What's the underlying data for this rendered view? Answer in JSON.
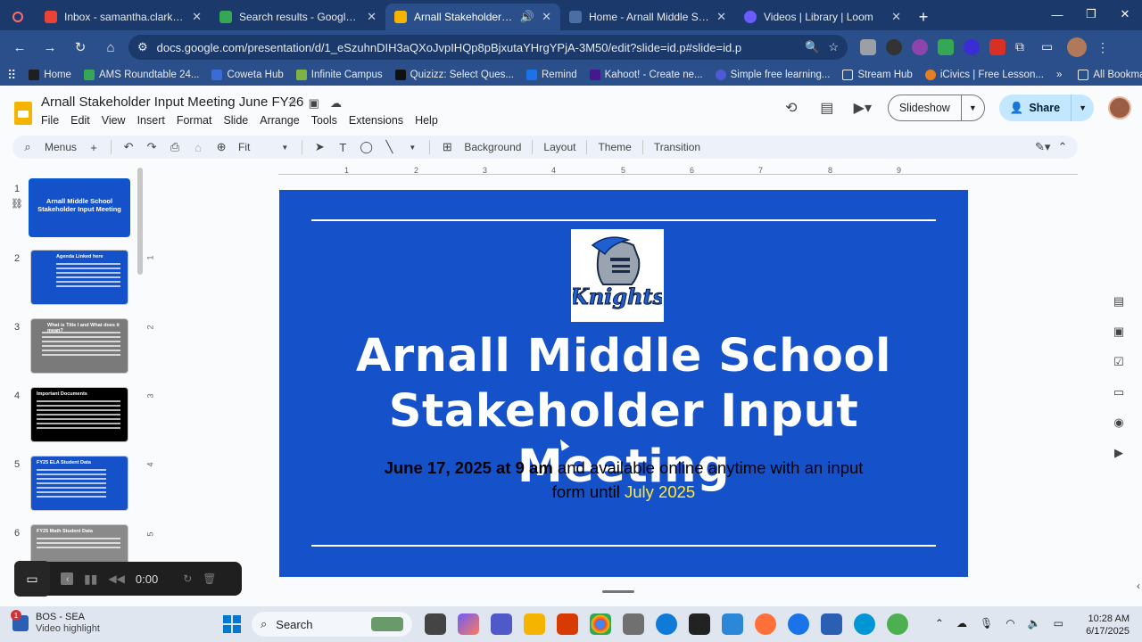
{
  "browser": {
    "tabs": [
      {
        "title": "Inbox - samantha.clark@coweta",
        "color": "#ea4335",
        "active": false
      },
      {
        "title": "Search results - Google Drive",
        "color": "#34a853",
        "active": false
      },
      {
        "title": "Arnall Stakeholder Input Me",
        "color": "#f4b400",
        "active": true
      },
      {
        "title": "Home - Arnall Middle School",
        "color": "#4a6fa5",
        "active": false
      },
      {
        "title": "Videos | Library | Loom",
        "color": "#6a5cff",
        "active": false
      }
    ],
    "url": "docs.google.com/presentation/d/1_eSzuhnDIH3aQXoJvpIHQp8pBjxutaYHrgYPjA-3M50/edit?slide=id.p#slide=id.p",
    "bookmarks": [
      "Home",
      "AMS Roundtable 24...",
      "Coweta Hub",
      "Infinite Campus",
      "Quizizz: Select Ques...",
      "Remind",
      "Kahoot! - Create ne...",
      "Simple free learning...",
      "Stream Hub",
      "iCivics | Free Lesson..."
    ],
    "all_bookmarks": "All Bookmarks"
  },
  "docs": {
    "title": "Arnall Stakeholder Input Meeting June FY26",
    "menu": [
      "File",
      "Edit",
      "View",
      "Insert",
      "Format",
      "Slide",
      "Arrange",
      "Tools",
      "Extensions",
      "Help"
    ],
    "slideshow_label": "Slideshow",
    "share_label": "Share"
  },
  "toolbar": {
    "menus_label": "Menus",
    "zoom_label": "Fit",
    "background": "Background",
    "layout": "Layout",
    "theme": "Theme",
    "transition": "Transition"
  },
  "ruler": {
    "h_ticks": [
      "1",
      "2",
      "3",
      "4",
      "5",
      "6",
      "7",
      "8",
      "9"
    ],
    "v_ticks": [
      "1",
      "2",
      "3",
      "4",
      "5"
    ]
  },
  "filmstrip": {
    "slides": [
      {
        "num": "1",
        "title": "Arnall Middle School Stakeholder Input Meeting"
      },
      {
        "num": "2",
        "title": "Agenda Linked here"
      },
      {
        "num": "3",
        "title": "What is Title I and What does it mean?"
      },
      {
        "num": "4",
        "title": "Important Documents"
      },
      {
        "num": "5",
        "title": "FY25 ELA Student Data"
      },
      {
        "num": "6",
        "title": "FY25 Math Student Data"
      }
    ]
  },
  "slide": {
    "title_line1": "Arnall Middle School",
    "title_line2": "Stakeholder Input Meeting",
    "sub_bold": "June 17,  2025 at 9 am",
    "sub_text": " and available online anytime with an input form until ",
    "sub_highlight": "July 2025",
    "logo_text": "Knights"
  },
  "loom": {
    "time": "0:00"
  },
  "taskbar": {
    "weather_title": "BOS - SEA",
    "weather_sub": "Video highlight",
    "badge": "1",
    "search_label": "Search",
    "time": "10:28 AM",
    "date": "6/17/2025"
  }
}
